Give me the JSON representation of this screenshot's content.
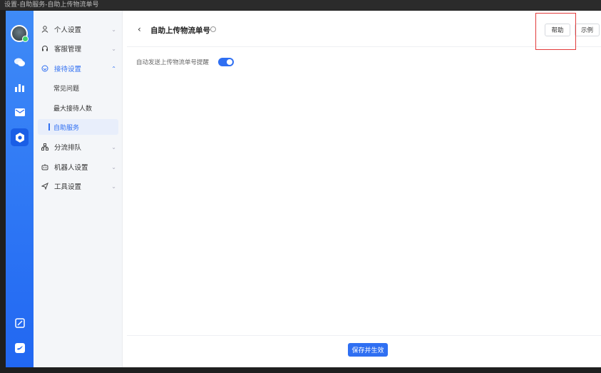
{
  "window_title": "设置-自助服务-自助上传物流单号",
  "nav": {
    "items": [
      {
        "label": "个人设置",
        "icon": "person-icon"
      },
      {
        "label": "客服管理",
        "icon": "headset-icon"
      },
      {
        "label": "接待设置",
        "icon": "reception-icon"
      },
      {
        "label": "分流排队",
        "icon": "org-chart-icon"
      },
      {
        "label": "机器人设置",
        "icon": "robot-icon"
      },
      {
        "label": "工具设置",
        "icon": "send-icon"
      }
    ],
    "sub_items": [
      "常见问题",
      "最大接待人数",
      "自助服务"
    ]
  },
  "header": {
    "title": "自助上传物流单号",
    "help_label": "帮助",
    "example_label": "示例"
  },
  "setting": {
    "label": "自动发送上传物流单号提醒",
    "enabled": true
  },
  "footer": {
    "save_label": "保存并生效"
  },
  "colors": {
    "accent": "#2f6ff2",
    "rail": "#2167f2",
    "highlight_box": "#e23b3b"
  }
}
